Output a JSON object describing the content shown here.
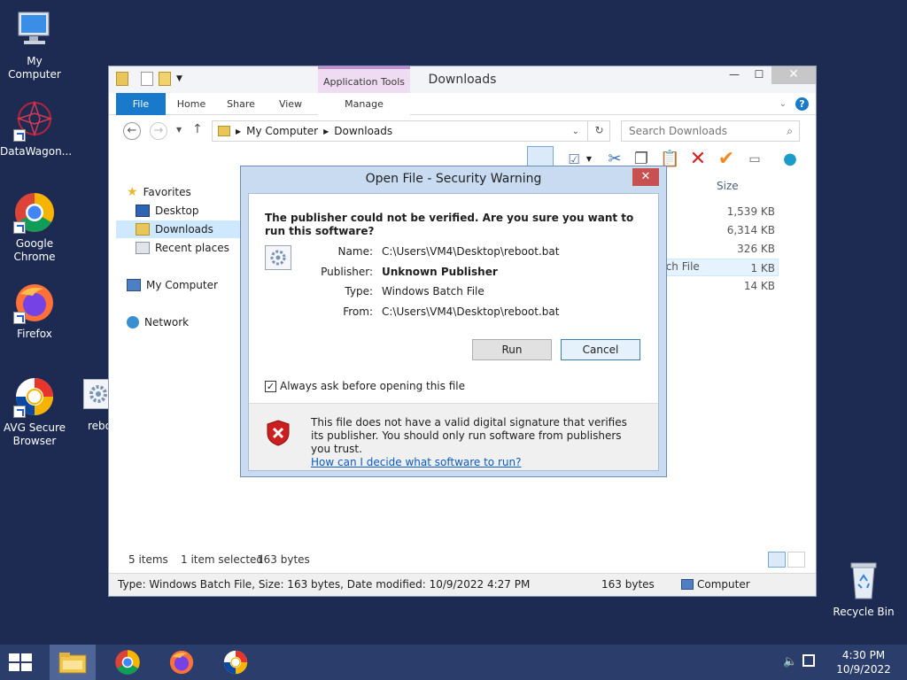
{
  "desktop": {
    "icons": [
      {
        "label": "My Computer",
        "icon": "computer-icon"
      },
      {
        "label": "DataWagon...",
        "icon": "datawagon-icon"
      },
      {
        "label": "Google Chrome",
        "icon": "chrome-icon"
      },
      {
        "label": "Firefox",
        "icon": "firefox-icon"
      },
      {
        "label": "AVG Secure Browser",
        "icon": "avg-browser-icon"
      },
      {
        "label": "rebo",
        "icon": "batch-file-icon"
      },
      {
        "label": "Recycle Bin",
        "icon": "recycle-bin-icon"
      }
    ]
  },
  "explorer": {
    "title": "Downloads",
    "app_tools_label": "Application Tools",
    "tabs": {
      "file": "File",
      "home": "Home",
      "share": "Share",
      "view": "View",
      "manage": "Manage"
    },
    "address": {
      "part1": "My Computer",
      "part2": "Downloads"
    },
    "search_placeholder": "Search Downloads",
    "nav": {
      "favorites": "Favorites",
      "desktop": "Desktop",
      "downloads": "Downloads",
      "recent": "Recent places",
      "computer": "My Computer",
      "network": "Network"
    },
    "size_header": "Size",
    "sizes": [
      "1,539 KB",
      "6,314 KB",
      "326 KB",
      "1 KB",
      "14 KB"
    ],
    "type_fragment": "tch File",
    "status": {
      "items": "5 items",
      "selected": "1 item selected",
      "selected_size": "163 bytes",
      "details": "Type: Windows Batch File, Size: 163 bytes, Date modified: 10/9/2022 4:27 PM",
      "bytes": "163 bytes",
      "location": "Computer"
    }
  },
  "dialog": {
    "title": "Open File - Security Warning",
    "heading": "The publisher could not be verified.  Are you sure you want to run this software?",
    "name_label": "Name:",
    "name_value": "C:\\Users\\VM4\\Desktop\\reboot.bat",
    "publisher_label": "Publisher:",
    "publisher_value": "Unknown Publisher",
    "type_label": "Type:",
    "type_value": "Windows Batch File",
    "from_label": "From:",
    "from_value": "C:\\Users\\VM4\\Desktop\\reboot.bat",
    "run_button": "Run",
    "cancel_button": "Cancel",
    "checkbox_label": "Always ask before opening this file",
    "checkbox_checked": true,
    "footer_text": "This file does not have a valid digital signature that verifies its publisher.  You should only run software from publishers you trust.",
    "footer_link": "How can I decide what software to run?"
  },
  "taskbar": {
    "time": "4:30 PM",
    "date": "10/9/2022"
  }
}
